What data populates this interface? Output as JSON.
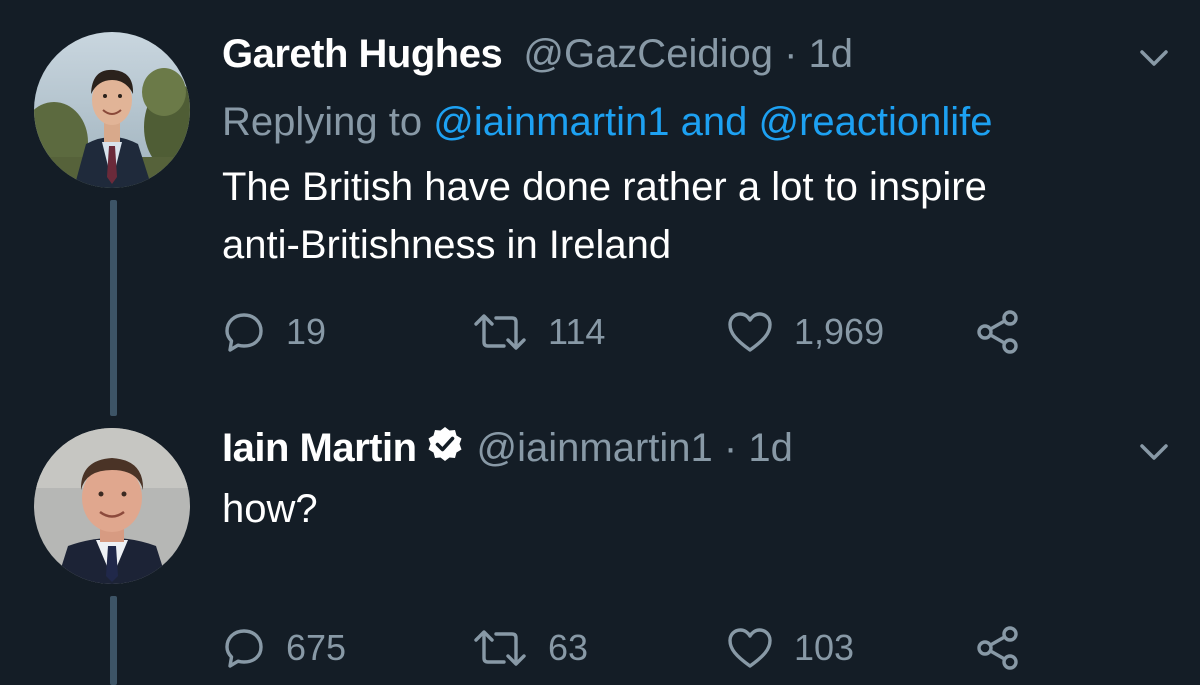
{
  "tweets": [
    {
      "display_name": "Gareth Hughes",
      "handle": "@GazCeidiog",
      "separator": "·",
      "time": "1d",
      "verified": false,
      "replying_prefix": "Replying to",
      "replying_to_1": "@iainmartin1",
      "replying_joiner": "and",
      "replying_to_2": "@reactionlife",
      "text_line_1": "The British have done rather a lot to inspire",
      "text_line_2": "anti-Britishness in Ireland",
      "replies": "19",
      "retweets": "114",
      "likes": "1,969"
    },
    {
      "display_name": "Iain Martin",
      "handle": "@iainmartin1",
      "separator": "·",
      "time": "1d",
      "verified": true,
      "text_line_1": "how?",
      "replies": "675",
      "retweets": "63",
      "likes": "103"
    }
  ],
  "icons": {
    "reply": "speech-bubble-icon",
    "retweet": "retweet-arrows-icon",
    "like": "heart-icon",
    "share": "share-icon",
    "menu": "chevron-down-icon",
    "verified": "verified-badge-icon"
  },
  "colors": {
    "background": "#141d26",
    "text_primary": "#ffffff",
    "text_secondary": "#8899a6",
    "link": "#1da1f2",
    "thread_line": "#3d5466"
  }
}
